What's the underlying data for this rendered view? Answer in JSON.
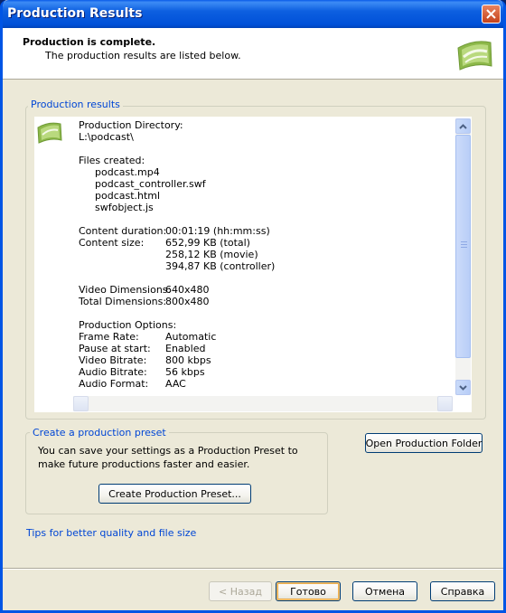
{
  "window": {
    "title": "Production Results",
    "header_title": "Production is complete.",
    "header_subtitle": "The production results are listed below."
  },
  "results": {
    "legend": "Production results",
    "directory_label": "Production Directory:",
    "directory_value": "L:\\podcast\\",
    "files_label": "Files created:",
    "files": [
      "podcast.mp4",
      "podcast_controller.swf",
      "podcast.html",
      "swfobject.js"
    ],
    "duration_label": "Content duration:",
    "duration_value": "00:01:19 (hh:mm:ss)",
    "size_label": "Content size:",
    "size_values": [
      "652,99 KB (total)",
      "258,12 KB (movie)",
      "394,87 KB (controller)"
    ],
    "video_dim_label": "Video Dimensions:",
    "video_dim_value": "640x480",
    "total_dim_label": "Total Dimensions:",
    "total_dim_value": "800x480",
    "options_label": "Production Options:",
    "options": [
      {
        "label": "Frame Rate:",
        "value": "Automatic"
      },
      {
        "label": "Pause at start:",
        "value": "Enabled"
      },
      {
        "label": "Video Bitrate:",
        "value": "800 kbps"
      },
      {
        "label": "Audio Bitrate:",
        "value": "56 kbps"
      },
      {
        "label": "Audio Format:",
        "value": "AAC"
      }
    ]
  },
  "preset": {
    "legend": "Create a production preset",
    "description": "You can save your settings as a Production Preset to make future productions faster and easier.",
    "create_button": "Create Production Preset..."
  },
  "open_folder_button": "Open Production Folder",
  "tips_link": "Tips for better quality and file size",
  "footer": {
    "back": "< Назад",
    "done": "Готово",
    "cancel": "Отмена",
    "help": "Справка"
  },
  "colors": {
    "accent_blue": "#0046D5",
    "titlebar": "#0054E3",
    "window_bg": "#ECE9D8"
  },
  "icons": [
    "close-icon",
    "camtasia-logo-icon",
    "scroll-up-arrow-icon",
    "scroll-down-arrow-icon"
  ]
}
